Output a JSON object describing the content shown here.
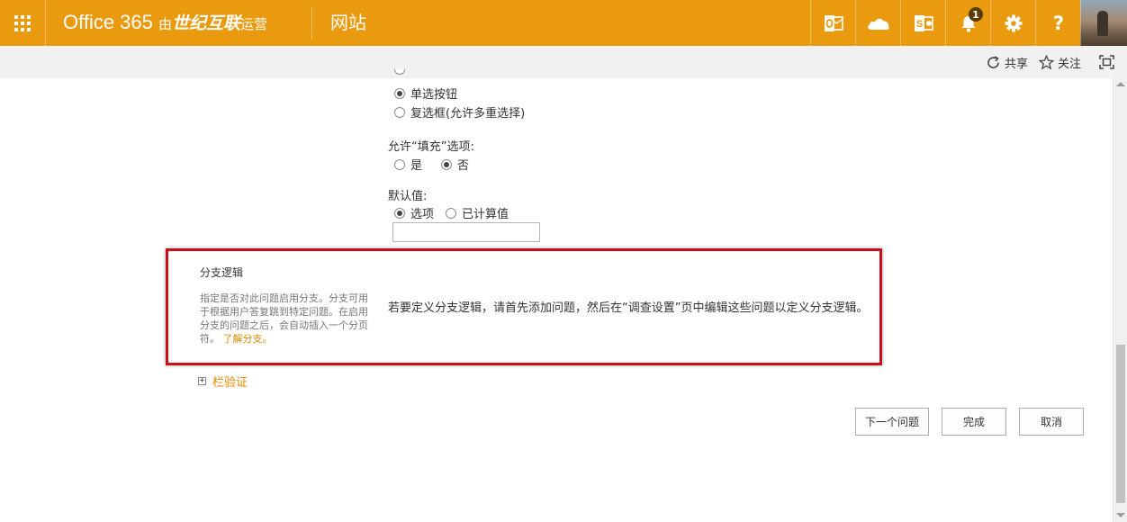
{
  "suite_bar": {
    "brand_name": "Office 365",
    "brand_operated_prefix": "由",
    "brand_operator": "世纪互联",
    "brand_operated_suffix": "运营",
    "site_name": "网站",
    "icons": [
      "app-launcher-icon",
      "outlook-icon",
      "onedrive-icon",
      "sharepoint-icon",
      "notification-bell-icon",
      "settings-gear-icon",
      "help-icon"
    ],
    "notification_count": "1",
    "color": "#ea9a0e"
  },
  "ribbon": {
    "share_label": "共享",
    "follow_label": "关注"
  },
  "form": {
    "display_options": [
      {
        "label": "单选按钮",
        "selected": true
      },
      {
        "label": "复选框(允许多重选择)",
        "selected": false
      }
    ],
    "fill_in_label": "允许“填充”选项:",
    "fill_in_options": [
      {
        "label": "是",
        "selected": false
      },
      {
        "label": "否",
        "selected": true
      }
    ],
    "default_label": "默认值:",
    "default_options": [
      {
        "label": "选项",
        "selected": true
      },
      {
        "label": "已计算值",
        "selected": false
      }
    ],
    "default_value": ""
  },
  "branching": {
    "title": "分支逻辑",
    "description": "指定是否对此问题启用分支。分支可用于根据用户答复跳到特定问题。在启用分支的问题之后，会自动插入一个分页符。",
    "learn_more": "了解分支。",
    "body": "若要定义分支逻辑，请首先添加问题，然后在“调查设置”页中编辑这些问题以定义分支逻辑。",
    "highlight_color": "#c8101a"
  },
  "column_validation": {
    "label": "栏验证"
  },
  "buttons": {
    "next_question": "下一个问题",
    "finish": "完成",
    "cancel": "取消"
  }
}
